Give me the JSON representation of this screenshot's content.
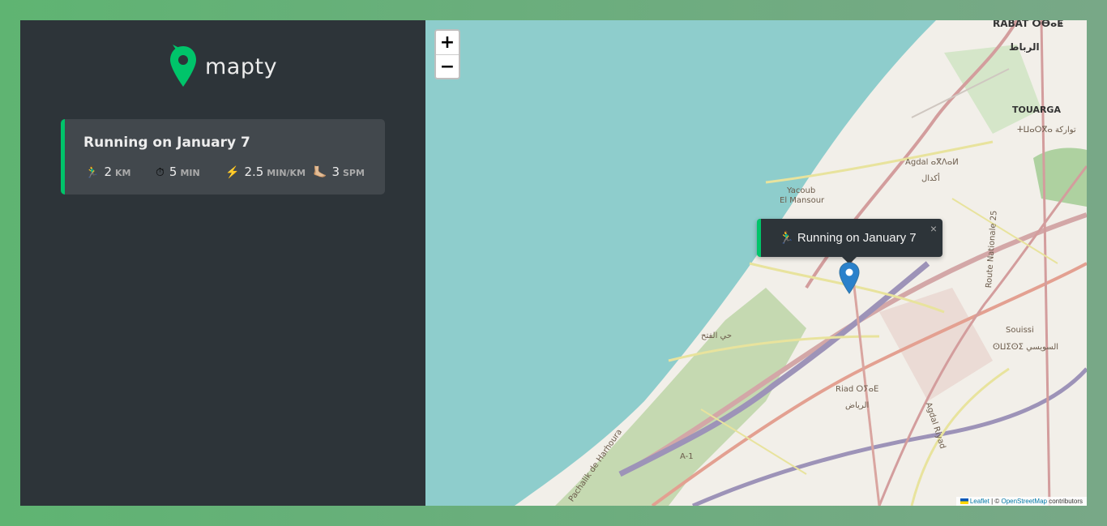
{
  "app": {
    "logo_text": "mapty"
  },
  "workouts": [
    {
      "title": "Running on January 7",
      "details": [
        {
          "icon": "🏃‍♂️",
          "icon_name": "runner-icon",
          "value": "2",
          "unit": "KM"
        },
        {
          "icon": "⏱",
          "icon_name": "stopwatch-icon",
          "value": "5",
          "unit": "MIN"
        },
        {
          "icon": "⚡️",
          "icon_name": "lightning-icon",
          "value": "2.5",
          "unit": "MIN/KM"
        },
        {
          "icon": "🦶🏼",
          "icon_name": "foot-icon",
          "value": "3",
          "unit": "SPM"
        }
      ]
    }
  ],
  "map": {
    "zoom_in": "+",
    "zoom_out": "−",
    "popup": {
      "icon": "🏃‍♂️",
      "text": "Running on January 7",
      "close": "×"
    },
    "attribution": {
      "leaflet": "Leaflet",
      "separator": " | © ",
      "osm": "OpenStreetMap",
      "suffix": " contributors"
    },
    "labels": {
      "rabat": "RABAT ⵔⴱⴰⵟ",
      "rabat_ar": "الرباط",
      "touarga": "TOUARGA",
      "touarga_ar": "ⵜⵡⴰⵔⴳⴰ تواركة",
      "agdal": "Agdal ⴰⴳⴷⴰⵍ",
      "agdal_ar": "أكدال",
      "yacoub": "Yacoub",
      "el_mansour": "El Mansour",
      "souissi": "Souissi",
      "souissi_ar": "ⵙⵡⵉⵙⵉ السويسي",
      "riad": "Riad ⵔⵢⴰⴹ",
      "riad_ar": "الرياض",
      "hay_el_fath": "حي الفتح",
      "route": "Route Nationale 25",
      "a1": "A-1",
      "agdal_riyad": "Agdal Riyad",
      "harhoura": "Pachalik de Harhoura"
    }
  },
  "colors": {
    "accent": "#00c46a",
    "sidebar_bg": "#2d3439",
    "card_bg": "#42484d",
    "sea": "#8ecdcc"
  }
}
